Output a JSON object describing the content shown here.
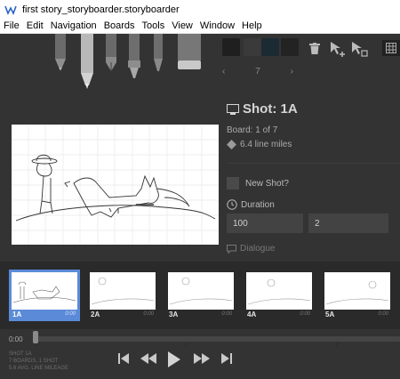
{
  "window": {
    "title": "first story_storyboarder.storyboarder"
  },
  "menu": [
    "File",
    "Edit",
    "Navigation",
    "Boards",
    "Tools",
    "View",
    "Window",
    "Help"
  ],
  "palette": {
    "colors": [
      "#1f1f1f",
      "#3a3a3a",
      "#1c2b33",
      "#232323"
    ],
    "number": "7"
  },
  "panel": {
    "shot_title": "Shot: 1A",
    "board_count": "Board: 1 of 7",
    "line_miles": "6.4 line miles",
    "new_shot_label": "New Shot?",
    "duration_label": "Duration",
    "duration_ms": "100",
    "duration_frames": "2",
    "dialogue_label": "Dialogue"
  },
  "thumbnails": [
    {
      "label": "1A",
      "duration": "0:00",
      "active": true
    },
    {
      "label": "2A",
      "duration": "0:00",
      "active": false
    },
    {
      "label": "3A",
      "duration": "0:00",
      "active": false
    },
    {
      "label": "4A",
      "duration": "0:00",
      "active": false
    },
    {
      "label": "5A",
      "duration": "0:00",
      "active": false
    }
  ],
  "playback": {
    "time": "0:00",
    "stats": [
      "SHOT 1A",
      "7 BOARDS, 1 SHOT",
      "5.6 AVG. LINE MILEAGE"
    ]
  },
  "icons": {
    "trash": "trash-icon",
    "add_board": "add-board-icon",
    "duplicate_board": "duplicate-board-icon",
    "grid": "grid-icon",
    "shot": "monitor-icon",
    "miles": "diamond-icon",
    "duration": "clock-icon",
    "dialogue": "speech-bubble-icon"
  }
}
